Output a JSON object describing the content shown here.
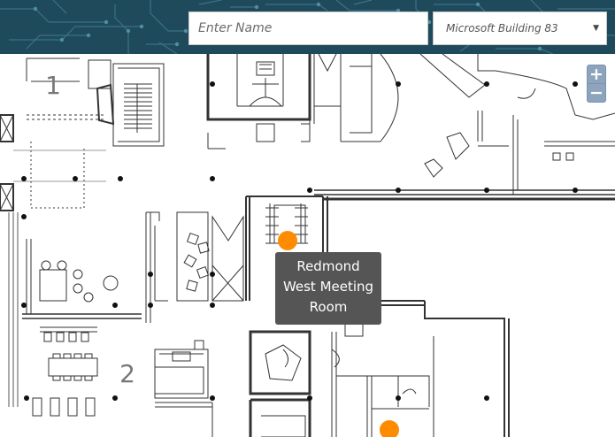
{
  "search": {
    "placeholder": "Enter Name",
    "value": ""
  },
  "building_select": {
    "selected": "Microsoft Building 83",
    "arrow": "▼"
  },
  "zoom": {
    "in_label": "+",
    "out_label": "−"
  },
  "floor_labels": {
    "zone_1": "1",
    "zone_2": "2"
  },
  "tooltip": {
    "line1": "Redmond",
    "line2": "West Meeting",
    "line3": "Room"
  },
  "colors": {
    "header_bg": "#1f4a5c",
    "pin": "#ff8c00",
    "tooltip_bg": "#555555",
    "zoom_button": "#8ea4bd"
  },
  "icons": {
    "header_background": "circuit-board-pattern",
    "dropdown": "chevron-down-icon",
    "room_marker": "location-pin-icon"
  }
}
